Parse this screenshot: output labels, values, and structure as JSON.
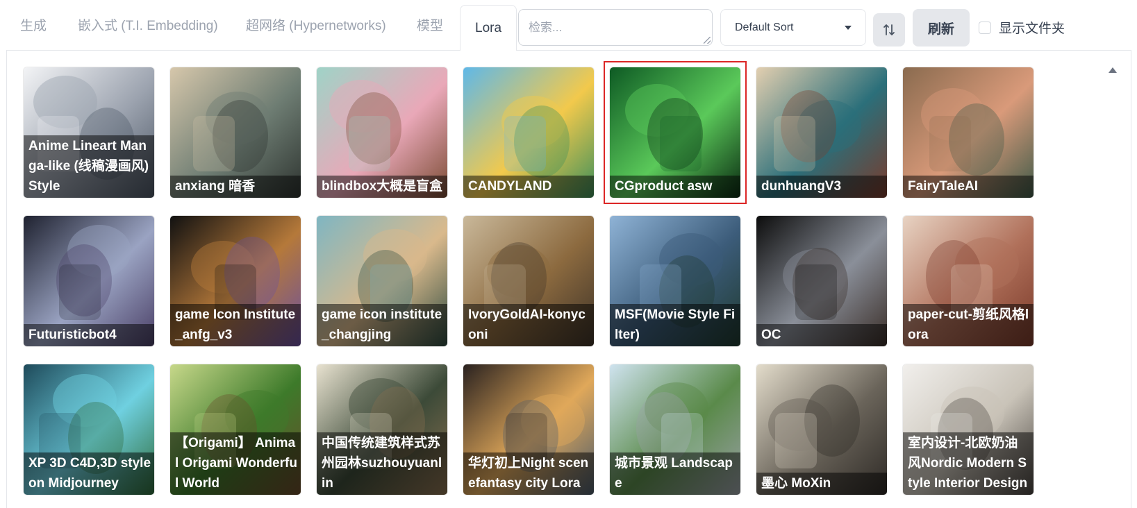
{
  "tabs": [
    {
      "label": "生成",
      "active": false
    },
    {
      "label": "嵌入式 (T.I. Embedding)",
      "active": false
    },
    {
      "label": "超网络 (Hypernetworks)",
      "active": false
    },
    {
      "label": "模型",
      "active": false
    },
    {
      "label": "Lora",
      "active": true
    }
  ],
  "toolbar": {
    "search_placeholder": "检索...",
    "search_value": "",
    "sort_selected": "Default Sort",
    "sort_direction_icon": "sort-direction-icon",
    "refresh_label": "刷新",
    "show_folders_label": "显示文件夹",
    "show_folders_checked": false
  },
  "selected_card": "CGproduct asw",
  "cards": [
    {
      "label": "Anime Lineart Manga-like (线稿漫画风) Style",
      "colors": [
        "#f3f4f6",
        "#9ca3af",
        "#4b5563"
      ]
    },
    {
      "label": "anxiang 暗香",
      "colors": [
        "#d6c7ab",
        "#6e7d73",
        "#2e3430"
      ]
    },
    {
      "label": "blindbox大概是盲盒",
      "colors": [
        "#9fd3c7",
        "#e9a8b8",
        "#7a4b33"
      ]
    },
    {
      "label": "CANDYLAND",
      "colors": [
        "#5fb8e8",
        "#f2c94c",
        "#3d8f5a"
      ]
    },
    {
      "label": "CGproduct asw",
      "colors": [
        "#0e5a24",
        "#5bc95a",
        "#0a2c12"
      ]
    },
    {
      "label": "dunhuangV3",
      "colors": [
        "#e3cfb0",
        "#2b6f7a",
        "#7a3b2c"
      ]
    },
    {
      "label": "FairyTaleAI",
      "colors": [
        "#8a6b4f",
        "#d99a7a",
        "#3f5a48"
      ]
    },
    {
      "label": "Futuristicbot4",
      "colors": [
        "#1f2230",
        "#9aa3c2",
        "#4a3f66"
      ]
    },
    {
      "label": "game Icon Institute_anfg_v3",
      "colors": [
        "#111111",
        "#b5793a",
        "#6a4fa0"
      ]
    },
    {
      "label": "game icon institute_changjing",
      "colors": [
        "#7fb6c2",
        "#d9b98c",
        "#2d4a3f"
      ]
    },
    {
      "label": "IvoryGoldAI-konyconi",
      "colors": [
        "#c9b89a",
        "#8c6a3f",
        "#3e3328"
      ]
    },
    {
      "label": "MSF(Movie Style Filter)",
      "colors": [
        "#8fb3d6",
        "#3c5c7a",
        "#1f3a2f"
      ]
    },
    {
      "label": "OC",
      "colors": [
        "#0d0d0d",
        "#8a8f99",
        "#3a2e28"
      ]
    },
    {
      "label": "paper-cut-剪纸风格lora",
      "colors": [
        "#e8d3c3",
        "#b0705a",
        "#7a3a2a"
      ]
    },
    {
      "label": "XP 3D C4D,3D style on Midjourney",
      "colors": [
        "#1e4a5a",
        "#6fd0e0",
        "#2f6b3a"
      ]
    },
    {
      "label": "【Origami】 Animal Origami Wonderful World",
      "colors": [
        "#c7d88a",
        "#3d7a2a",
        "#6a4a2a"
      ]
    },
    {
      "label": "中国传统建筑样式苏州园林suzhouyuanlin",
      "colors": [
        "#e8e2d0",
        "#3c4a38",
        "#8a7050"
      ]
    },
    {
      "label": "华灯初上Night scenefantasy city Lora",
      "colors": [
        "#2a2220",
        "#e0a85a",
        "#4a5a6a"
      ]
    },
    {
      "label": "城市景观 Landscape",
      "colors": [
        "#cfe3ef",
        "#5a8a4a",
        "#9aa0a6"
      ]
    },
    {
      "label": "墨心 MoXin",
      "colors": [
        "#e3dccb",
        "#6a645a",
        "#2e2a26"
      ]
    },
    {
      "label": "室内设计-北欧奶油风Nordic Modern Style Interior Design",
      "colors": [
        "#f1efec",
        "#c9c3b8",
        "#4a4540"
      ]
    }
  ]
}
